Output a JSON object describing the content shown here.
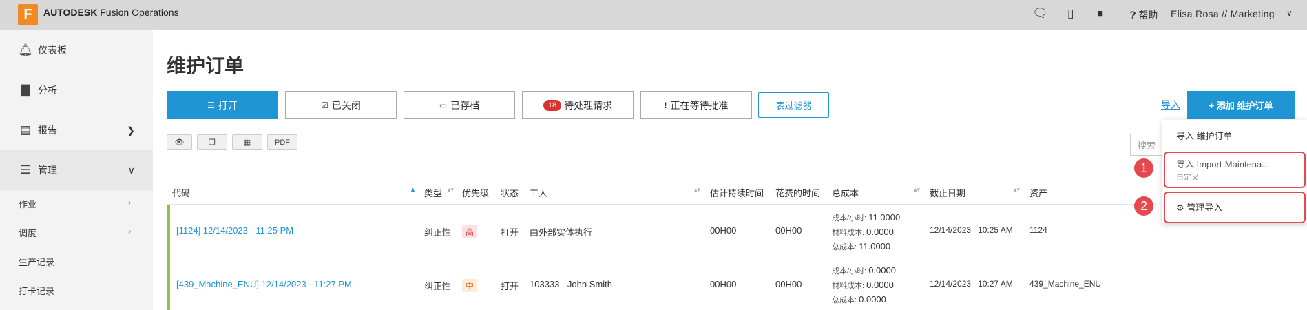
{
  "header": {
    "logo_letter": "F",
    "brand_bold": "AUTODESK",
    "brand_rest": " Fusion Operations",
    "help_label": "帮助",
    "user_label": "Elisa Rosa // Marketing"
  },
  "sidebar": {
    "items": [
      {
        "label": "仪表板",
        "icon": "bell-icon"
      },
      {
        "label": "分析",
        "icon": "bar-chart-icon"
      },
      {
        "label": "报告",
        "icon": "report-icon"
      },
      {
        "label": "管理",
        "icon": "management-icon"
      }
    ],
    "subitems": [
      "作业",
      "调度",
      "生产记录",
      "打卡记录"
    ]
  },
  "main": {
    "title": "维护订单",
    "tabs": [
      {
        "label": "打开",
        "icon": "list-icon"
      },
      {
        "label": "已关闭",
        "icon": "check-square-icon"
      },
      {
        "label": "已存档",
        "icon": "archive-icon"
      },
      {
        "label": "待处理请求",
        "badge": "18"
      },
      {
        "label": "正在等待批准",
        "icon": "exclamation-icon"
      }
    ],
    "filter_label": "表过滤器",
    "import_label": "导入",
    "add_label": "+ 添加 维护订单",
    "tools": [
      "eye-icon",
      "copy-icon",
      "table-icon",
      "PDF"
    ],
    "search_placeholder": "搜索"
  },
  "table": {
    "headers": [
      "代码",
      "类型",
      "优先级",
      "状态",
      "工人",
      "估计持续时间",
      "花费的时间",
      "总成本",
      "截止日期",
      "资产"
    ],
    "rows": [
      {
        "code": "[1124] 12/14/2023 - 11:25 PM",
        "type": "纠正性",
        "priority": "高",
        "status": "打开",
        "worker": "由外部实体执行",
        "est": "00H00",
        "spent": "00H00",
        "cost_hour_label": "成本/小时:",
        "cost_hour": "11.0000",
        "cost_material_label": "材料成本:",
        "cost_material": "0.0000",
        "cost_total_label": "总成本:",
        "cost_total": "11.0000",
        "due": "12/14/2023",
        "due_time": "10:25 AM",
        "asset": "1124"
      },
      {
        "code": "[439_Machine_ENU] 12/14/2023 - 11:27 PM",
        "type": "纠正性",
        "priority": "中",
        "status": "打开",
        "worker": "103333 - John Smith",
        "est": "00H00",
        "spent": "00H00",
        "cost_hour_label": "成本/小时:",
        "cost_hour": "0.0000",
        "cost_material_label": "材料成本:",
        "cost_material": "0.0000",
        "cost_total_label": "总成本:",
        "cost_total": "0.0000",
        "due": "12/14/2023",
        "due_time": "10:27 AM",
        "asset": "439_Machine_ENU"
      }
    ]
  },
  "dropdown": {
    "item1": "导入 维护订单",
    "item2": "导入 Import-Maintena...",
    "item2_sub": "自定义",
    "item3": "管理导入",
    "markers": [
      "1",
      "2"
    ]
  },
  "colors": {
    "accent": "#1f96d3",
    "logo": "#f08a24",
    "highlight": "#e5484d",
    "status_bar": "#8bc34a"
  }
}
